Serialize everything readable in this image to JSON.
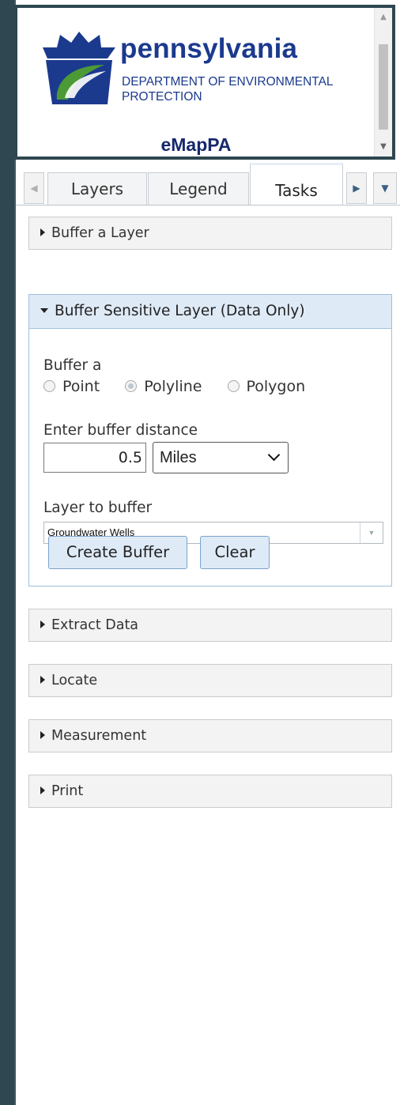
{
  "header": {
    "logo_title": "pennsylvania",
    "logo_subtitle_line1": "DEPARTMENT OF ENVIRONMENTAL",
    "logo_subtitle_line2": "PROTECTION",
    "app_name": "eMapPA"
  },
  "tabs": [
    {
      "label": "Layers",
      "active": false
    },
    {
      "label": "Legend",
      "active": false
    },
    {
      "label": "Tasks",
      "active": true
    }
  ],
  "tasks": {
    "buffer_layer": {
      "label": "Buffer a Layer",
      "expanded": false
    },
    "buffer_sensitive": {
      "label": "Buffer Sensitive Layer (Data Only)",
      "expanded": true,
      "buffer_a_label": "Buffer a",
      "geometry_options": [
        {
          "label": "Point",
          "checked": false
        },
        {
          "label": "Polyline",
          "checked": true
        },
        {
          "label": "Polygon",
          "checked": false
        }
      ],
      "distance_label": "Enter buffer distance",
      "distance_value": "0.5",
      "unit_selected": "Miles",
      "layer_label": "Layer to buffer",
      "layer_selected": "Groundwater Wells",
      "create_button": "Create Buffer",
      "clear_button": "Clear"
    },
    "extract_data": {
      "label": "Extract Data",
      "expanded": false
    },
    "locate": {
      "label": "Locate",
      "expanded": false
    },
    "measurement": {
      "label": "Measurement",
      "expanded": false
    },
    "print": {
      "label": "Print",
      "expanded": false
    }
  },
  "colors": {
    "brand_blue": "#1b3a8e",
    "frame": "#2e4750",
    "accent_light": "#dfeaf7",
    "logo_green": "#3f8f2e"
  }
}
